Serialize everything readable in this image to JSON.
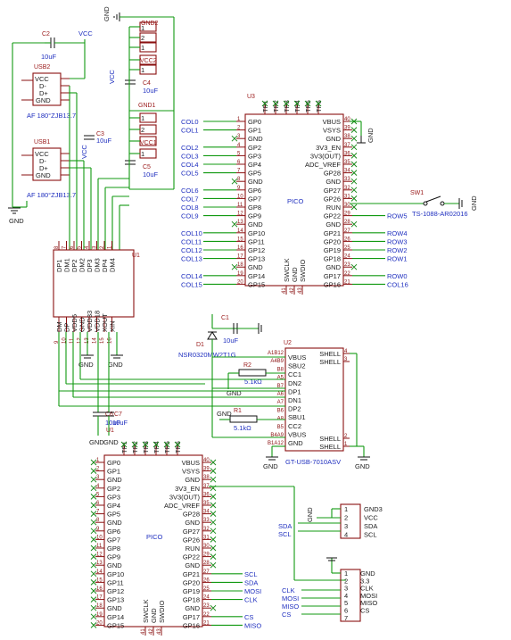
{
  "colors": {
    "wire": "#119911",
    "component": "#8a1010",
    "net_label": "#1f2fbf",
    "no_connect": "#1a8a1a"
  },
  "gnd": "GND",
  "vcc": "VCC",
  "usb_a": {
    "ref": "USB2",
    "part": "AF 180°ZJB13.7",
    "pins": [
      "VCC",
      "D-",
      "D+",
      "GND"
    ]
  },
  "usb_b": {
    "ref": "USB1",
    "part": "AF 180°ZJB13.7",
    "pins": [
      "VCC",
      "D-",
      "D+",
      "GND"
    ]
  },
  "caps": {
    "c2": {
      "ref": "C2",
      "val": "10uF"
    },
    "c3": {
      "ref": "C3",
      "val": "10uF"
    },
    "c4": {
      "ref": "C4",
      "val": "10uF"
    },
    "c5": {
      "ref": "C5",
      "val": "10uF"
    },
    "c1": {
      "ref": "C1",
      "val": "10uF"
    },
    "c6": {
      "ref": "C6",
      "val": "10uF"
    },
    "c7": {
      "ref": "C7",
      "val": "10uF"
    }
  },
  "headers": {
    "gnd2": "GND2",
    "vcc2": "VCC2",
    "gnd1": "GND1",
    "vcc1": "VCC1",
    "pin1": "1",
    "pin2": "2"
  },
  "u3": {
    "ref": "U3",
    "name": "PICO",
    "top_pins": [
      "TP1",
      "TP2",
      "TP3",
      "TP4",
      "TP5",
      "TP6"
    ],
    "left_pins": [
      "GP0",
      "GP1",
      "GND",
      "GP2",
      "GP3",
      "GP4",
      "GP5",
      "GND",
      "GP6",
      "GP7",
      "GP8",
      "GP9",
      "GND",
      "GP10",
      "GP11",
      "GP12",
      "GP13",
      "GND",
      "GP14",
      "GP15"
    ],
    "right_pins": [
      "VBUS",
      "VSYS",
      "GND",
      "3V3_EN",
      "3V3(OUT)",
      "ADC_VREF",
      "GP28",
      "GND",
      "GP27",
      "GP26",
      "RUN",
      "GP22",
      "GND",
      "GP21",
      "GP20",
      "GP19",
      "GP18",
      "GND",
      "GP17",
      "GP16"
    ],
    "bottom_pins": [
      "SWCLK",
      "GND",
      "SWDIO"
    ],
    "left_nums": [
      "1",
      "2",
      "3",
      "4",
      "5",
      "6",
      "7",
      "8",
      "9",
      "10",
      "11",
      "12",
      "13",
      "14",
      "15",
      "16",
      "17",
      "18",
      "19",
      "20"
    ],
    "right_nums": [
      "40",
      "39",
      "38",
      "37",
      "36",
      "35",
      "34",
      "33",
      "32",
      "31",
      "30",
      "29",
      "28",
      "27",
      "26",
      "25",
      "24",
      "23",
      "22",
      "21"
    ],
    "bottom_nums": [
      "41",
      "42",
      "43"
    ]
  },
  "u3_left_nets": [
    "COL0",
    "COL1",
    "",
    "COL2",
    "COL3",
    "COL4",
    "COL5",
    "",
    "COL6",
    "COL7",
    "COL8",
    "COL9",
    "",
    "COL10",
    "COL11",
    "COL12",
    "COL13",
    "",
    "COL14",
    "COL15"
  ],
  "u3_right_nets": [
    "",
    "",
    "",
    "",
    "",
    "",
    "",
    "",
    "",
    "",
    "",
    "ROW5",
    "",
    "ROW4",
    "ROW3",
    "ROW2",
    "ROW1",
    "",
    "ROW0",
    "COL16"
  ],
  "sw1": {
    "ref": "SW1",
    "part": "TS-1088-AR02016"
  },
  "u1": {
    "ref": "U1",
    "top_pins": [
      "DP1",
      "DM1",
      "DP2",
      "DM2",
      "DP3",
      "DM3",
      "DP4",
      "DM4"
    ],
    "top_nums": [
      "8",
      "7",
      "6",
      "5",
      "4",
      "3",
      "2",
      "1"
    ],
    "bottom_pins": [
      "DM",
      "DP",
      "VDD5",
      "GND",
      "VDD33",
      "VDD18",
      "XOUT",
      "XIN"
    ],
    "bottom_nums": [
      "9",
      "10",
      "11",
      "12",
      "13",
      "14",
      "15",
      "16"
    ]
  },
  "d1": {
    "ref": "D1",
    "part": "NSR0320MW2T1G"
  },
  "r2": {
    "ref": "R2",
    "val": "5.1kΩ"
  },
  "r1": {
    "ref": "R1",
    "val": "5.1kΩ"
  },
  "u2": {
    "ref": "U2",
    "part": "GT-USB-7010ASV",
    "left_pins": [
      "VBUS",
      "SBU2",
      "CC1",
      "DN2",
      "DP1",
      "DN1",
      "DP2",
      "SBU1",
      "CC2",
      "VBUS",
      "GND"
    ],
    "left_nums": [
      "A1B12",
      "A4B9",
      "B8",
      "A5",
      "B7",
      "A6",
      "A7",
      "B6",
      "A8",
      "B5",
      "B4A9",
      "B1A12"
    ],
    "right_pins": [
      "SHELL",
      "SHELL",
      "SHELL",
      "SHELL"
    ],
    "right_nums": [
      "4",
      "3",
      "2",
      "1"
    ]
  },
  "u4": {
    "ref": "U4",
    "name": "PICO",
    "right_nets": [
      "",
      "",
      "",
      "",
      "",
      "",
      "",
      "",
      "",
      "",
      "",
      "",
      "",
      "SCL",
      "SDA",
      "MOSI",
      "CLK",
      "",
      "CS",
      "MISO"
    ]
  },
  "conn_top": {
    "pins": [
      "1",
      "2",
      "3",
      "4"
    ],
    "labels": [
      "GND3",
      "VCC",
      "SDA",
      "SCL"
    ],
    "nets": [
      "SDA",
      "SCL"
    ]
  },
  "conn_bottom": {
    "pins": [
      "1",
      "2",
      "3",
      "4",
      "5",
      "6",
      "7"
    ],
    "labels": [
      "GND",
      "3.3",
      "CLK",
      "MOSI",
      "MISO",
      "CS"
    ],
    "nets": [
      "CLK",
      "MOSI",
      "MISO",
      "CS"
    ]
  }
}
